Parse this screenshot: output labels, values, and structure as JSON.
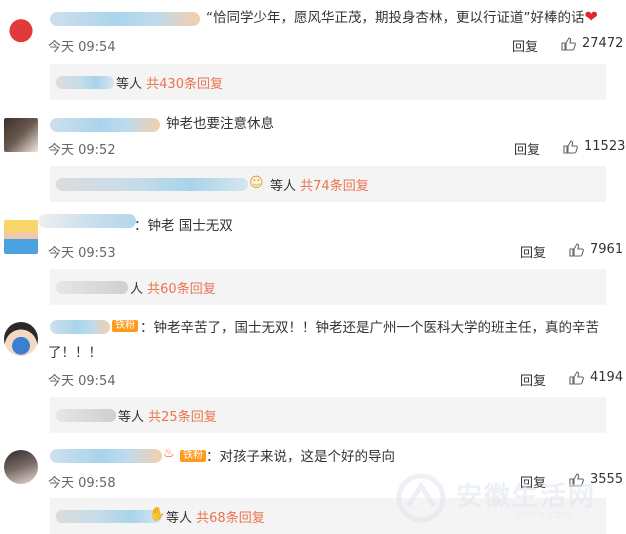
{
  "comments": [
    {
      "text": "“恰同学少年，愿风华正茂，期投身杏林，更以行证道”好棒的话",
      "emoji": "❤",
      "time": "今天 09:54",
      "reply": "回复",
      "likes": "27472",
      "reply_box": {
        "mid": "等人",
        "count": "共430条回复"
      }
    },
    {
      "text": "钟老也要注意休息",
      "time": "今天 09:52",
      "reply": "回复",
      "likes": "11523",
      "reply_box": {
        "mid": "等人",
        "count": "共74条回复"
      }
    },
    {
      "text": "：钟老 国士无双",
      "time": "今天 09:53",
      "reply": "回复",
      "likes": "7961",
      "reply_box": {
        "mid": "人",
        "count": "共60条回复"
      }
    },
    {
      "badge": "铁粉",
      "text": "：钟老辛苦了，国士无双！！钟老还是广州一个医科大学的班主任，真的辛苦",
      "text2": "了！！！",
      "time": "今天 09:54",
      "reply": "回复",
      "likes": "4194",
      "reply_box": {
        "mid": "等人",
        "count": "共25条回复"
      }
    },
    {
      "badge": "铁粉",
      "text": "：对孩子来说，这是个好的导向",
      "time": "今天 09:58",
      "reply": "回复",
      "likes": "3555",
      "reply_box": {
        "mid": "等人",
        "count": "共68条回复"
      }
    }
  ],
  "watermark": {
    "name": "安徽生活网",
    "url": "ahlife.com"
  }
}
